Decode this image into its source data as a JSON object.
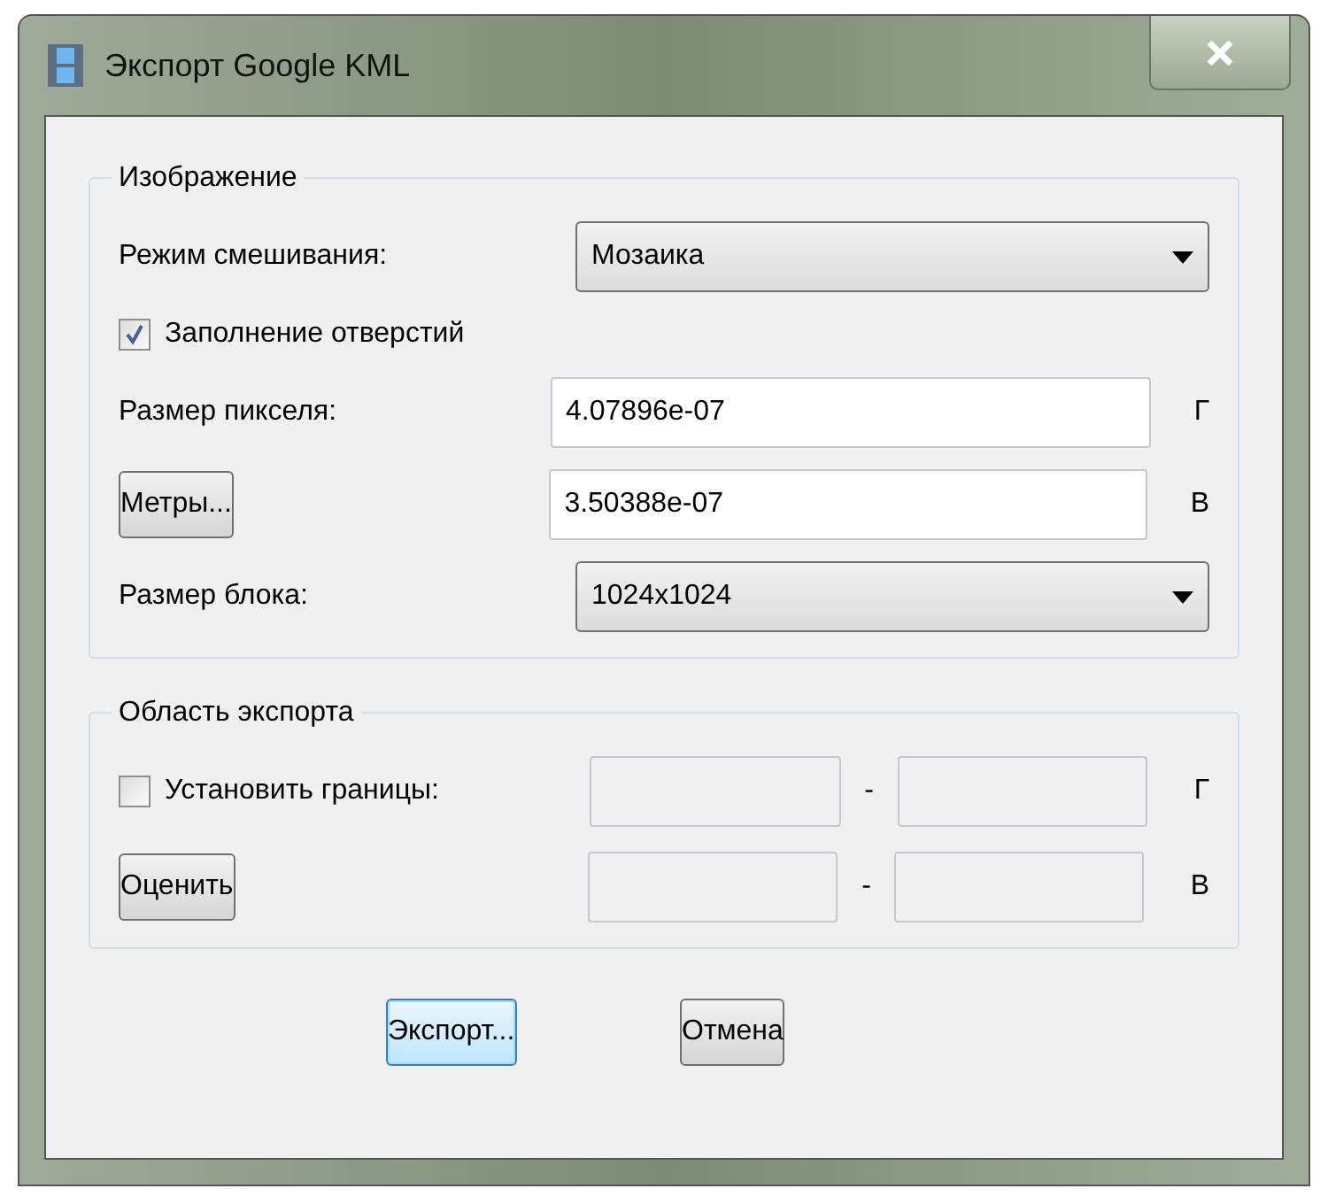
{
  "window": {
    "title": "Экспорт Google KML"
  },
  "image_group": {
    "title": "Изображение",
    "blend_mode": {
      "label": "Режим смешивания:",
      "value": "Мозаика"
    },
    "fill_holes": {
      "label": "Заполнение отверстий",
      "checked": true
    },
    "pixel_size": {
      "label": "Размер пикселя:",
      "value": "4.07896e-07",
      "unit": "Г"
    },
    "meters": {
      "button": "Метры...",
      "value": "3.50388e-07",
      "unit": "В"
    },
    "block_size": {
      "label": "Размер блока:",
      "value": "1024x1024"
    }
  },
  "export_group": {
    "title": "Область экспорта",
    "set_bounds": {
      "label": "Установить границы:",
      "checked": false,
      "separator": "-",
      "unit": "Г"
    },
    "estimate": {
      "button": "Оценить",
      "separator": "-",
      "unit": "В"
    }
  },
  "buttons": [
    {
      "label": "Экспорт...",
      "selected": true
    },
    {
      "label": "Отмена",
      "selected": false
    }
  ]
}
